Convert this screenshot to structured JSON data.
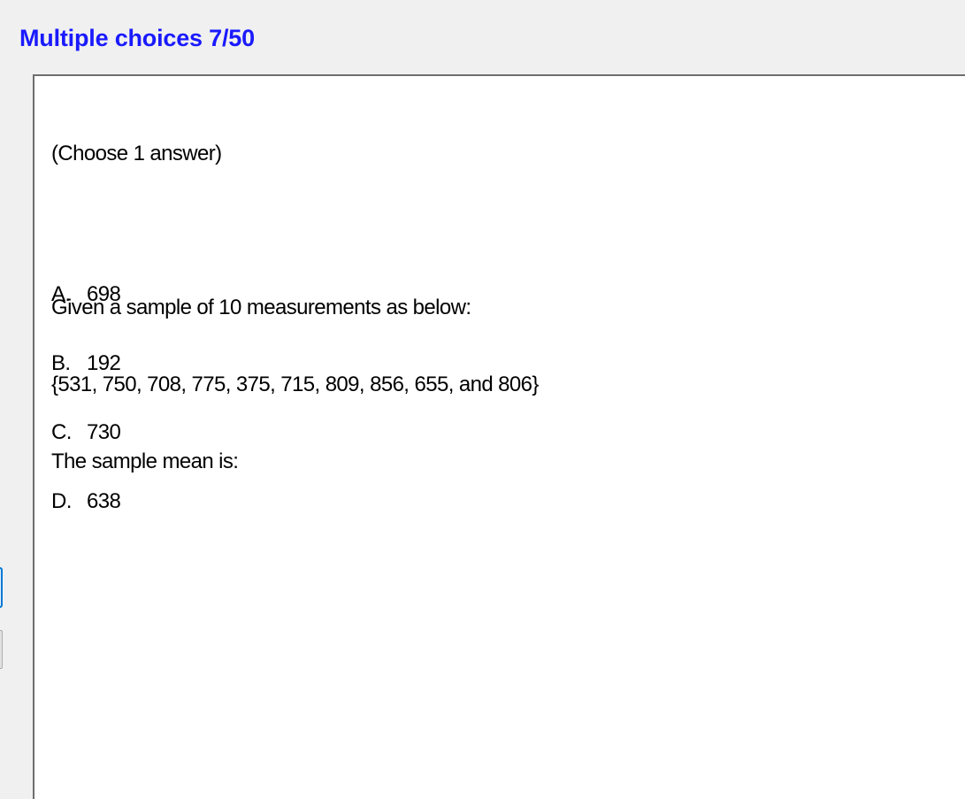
{
  "header": {
    "title": "Multiple choices 7/50"
  },
  "question": {
    "instruction": "(Choose 1 answer)",
    "lines": [
      "Given a sample of 10 measurements as below:",
      "{531, 750, 708, 775, 375, 715, 809, 856, 655, and 806}",
      "The sample mean is:"
    ]
  },
  "options": [
    {
      "letter": "A.",
      "value": "698"
    },
    {
      "letter": "B.",
      "value": "192"
    },
    {
      "letter": "C.",
      "value": "730"
    },
    {
      "letter": "D.",
      "value": "638"
    }
  ],
  "colors": {
    "title": "#1a1aff",
    "focus_border": "#0078d7"
  }
}
